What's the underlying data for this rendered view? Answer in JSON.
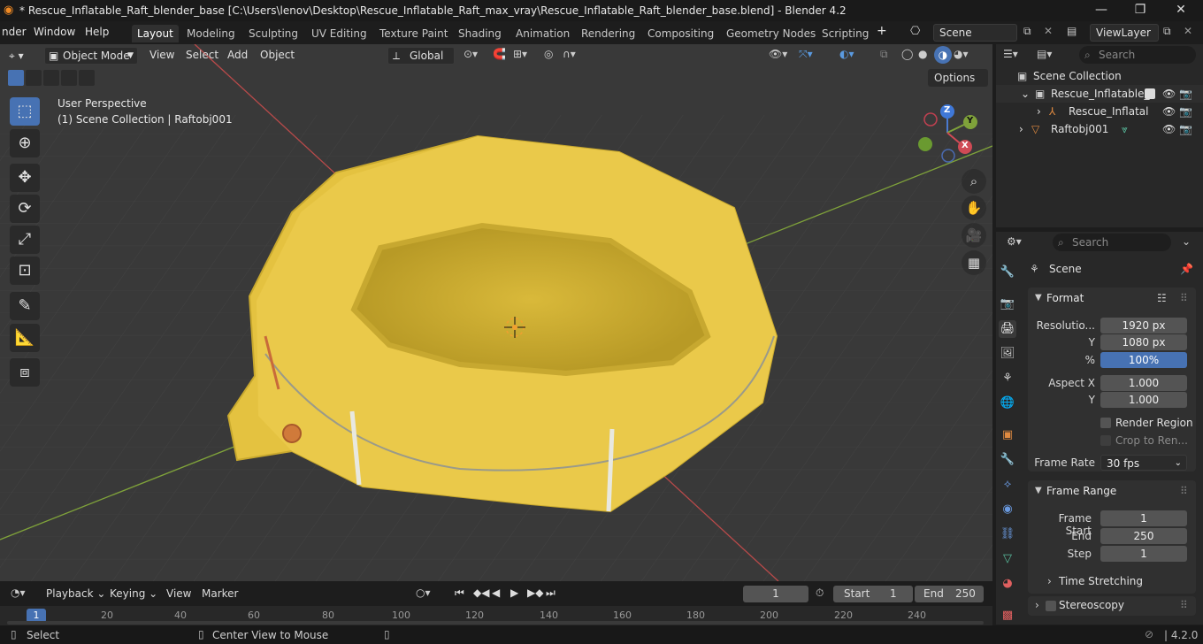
{
  "window": {
    "title": "* Rescue_Inflatable_Raft_blender_base [C:\\Users\\lenov\\Desktop\\Rescue_Inflatable_Raft_max_vray\\Rescue_Inflatable_Raft_blender_base.blend] - Blender 4.2",
    "minimize": "—",
    "maximize": "❐",
    "close": "✕"
  },
  "menus": [
    "nder",
    "Window",
    "Help"
  ],
  "workspaces": [
    "Layout",
    "Modeling",
    "Sculpting",
    "UV Editing",
    "Texture Paint",
    "Shading",
    "Animation",
    "Rendering",
    "Compositing",
    "Geometry Nodes",
    "Scripting"
  ],
  "workspace_add": "+",
  "scene": {
    "name": "Scene",
    "view_layer": "ViewLayer"
  },
  "viewport": {
    "mode": "Object Mode",
    "menus": [
      "View",
      "Select",
      "Add",
      "Object"
    ],
    "transform_orientation": "Global",
    "options": "Options",
    "overlay_line1": "User Perspective",
    "overlay_line2": "(1) Scene Collection | Raftobj001",
    "gizmo": {
      "x": "X",
      "y": "Y",
      "z": "Z"
    }
  },
  "outliner": {
    "search_placeholder": "Search",
    "items": [
      {
        "label": "Scene Collection"
      },
      {
        "label": "Rescue_Inflatable_"
      },
      {
        "label": "Rescue_Inflatal"
      },
      {
        "label": "Raftobj001"
      }
    ]
  },
  "properties": {
    "search_placeholder": "Search",
    "context": "Scene",
    "format": {
      "header": "Format",
      "resolution_x_label": "Resolutio...",
      "resolution_x": "1920 px",
      "resolution_y_label": "Y",
      "resolution_y": "1080 px",
      "percent_label": "%",
      "percent": "100%",
      "percent_value": 1.0,
      "aspect_x_label": "Aspect X",
      "aspect_x": "1.000",
      "aspect_y_label": "Y",
      "aspect_y": "1.000",
      "render_region": "Render Region",
      "crop": "Crop to Ren...",
      "frame_rate_label": "Frame Rate",
      "frame_rate": "30 fps"
    },
    "frame_range": {
      "header": "Frame Range",
      "start_label": "Frame Start",
      "start": "1",
      "end_label": "End",
      "end": "250",
      "step_label": "Step",
      "step": "1",
      "time_stretching": "Time Stretching"
    },
    "stereoscopy": "Stereoscopy"
  },
  "timeline": {
    "menus": [
      "Playback",
      "Keying",
      "View",
      "Marker"
    ],
    "current_frame": "1",
    "start_label": "Start",
    "start": "1",
    "end_label": "End",
    "end": "250",
    "ruler": [
      "1",
      "20",
      "40",
      "60",
      "80",
      "100",
      "120",
      "140",
      "160",
      "180",
      "200",
      "220",
      "240"
    ]
  },
  "status": {
    "select": "Select",
    "center": "Center View to Mouse",
    "version": "4.2.0"
  },
  "colors": {
    "accent": "#4772b3",
    "raft": "#e8c64a",
    "grid_bg": "#393939",
    "axis_x": "#b84a4a",
    "axis_y": "#7fa23a"
  }
}
